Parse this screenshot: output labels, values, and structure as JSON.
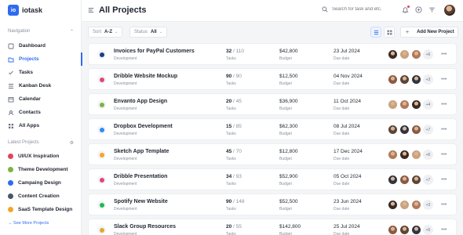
{
  "brand": {
    "mark": "io",
    "name": "iotask"
  },
  "sidebar": {
    "nav_heading": "Navigation",
    "nav_items": [
      {
        "label": "Dashboard",
        "icon": "dashboard-icon",
        "active": false
      },
      {
        "label": "Projects",
        "icon": "folder-icon",
        "active": true
      },
      {
        "label": "Tasks",
        "icon": "tasks-icon",
        "active": false
      },
      {
        "label": "Kanban Desk",
        "icon": "kanban-icon",
        "active": false
      },
      {
        "label": "Calendar",
        "icon": "calendar-icon",
        "active": false
      },
      {
        "label": "Contacts",
        "icon": "contacts-icon",
        "active": false
      },
      {
        "label": "All Apps",
        "icon": "apps-icon",
        "active": false
      }
    ],
    "latest_heading": "Latest Projects",
    "latest_items": [
      {
        "label": "UI/UX Inspiration",
        "color": "#e2445c"
      },
      {
        "label": "Theme Development",
        "color": "#7cb342"
      },
      {
        "label": "Campaing Design",
        "color": "#2f6bf0"
      },
      {
        "label": "Content Creation",
        "color": "#4a5568"
      },
      {
        "label": "SaaS Template Design",
        "color": "#f5a524"
      }
    ],
    "see_more": "See More Projects"
  },
  "header": {
    "title": "All Projects",
    "search_placeholder": "Search for task and etc."
  },
  "toolbar": {
    "sort_label": "Sort",
    "sort_value": "A-Z",
    "status_label": "Status",
    "status_value": "All",
    "add_label": "Add New Project"
  },
  "labels": {
    "tasks": "Tasks",
    "budget": "Budget",
    "due": "Due date"
  },
  "projects": [
    {
      "name": "Invoices for PayPal Customers",
      "category": "Development",
      "tasks_done": "32",
      "tasks_total": "/ 110",
      "budget": "$42,800",
      "due": "23 Jul 2024",
      "more": "+6",
      "icon_color": "#1a3d8f"
    },
    {
      "name": "Dribble Website Mockup",
      "category": "Development",
      "tasks_done": "90",
      "tasks_total": "/ 90",
      "budget": "$12,500",
      "due": "04 Nov 2024",
      "more": "+3",
      "icon_color": "#e2447c"
    },
    {
      "name": "Envanto App Design",
      "category": "Development",
      "tasks_done": "20",
      "tasks_total": "/ 45",
      "budget": "$36,900",
      "due": "11 Oct 2024",
      "more": "+4",
      "icon_color": "#7cb342"
    },
    {
      "name": "Dropbox Development",
      "category": "Development",
      "tasks_done": "15",
      "tasks_total": "/ 85",
      "budget": "$62,300",
      "due": "08 Jul 2024",
      "more": "+7",
      "icon_color": "#2f8bf0"
    },
    {
      "name": "Sketch App Template",
      "category": "Development",
      "tasks_done": "45",
      "tasks_total": "/ 70",
      "budget": "$12,800",
      "due": "17 Dec 2024",
      "more": "+6",
      "icon_color": "#f5a524"
    },
    {
      "name": "Dribble Presentation",
      "category": "Development",
      "tasks_done": "34",
      "tasks_total": "/ 93",
      "budget": "$52,900",
      "due": "05 Oct 2024",
      "more": "+7",
      "icon_color": "#e2447c"
    },
    {
      "name": "Spotify New Website",
      "category": "Development",
      "tasks_done": "90",
      "tasks_total": "/ 148",
      "budget": "$52,500",
      "due": "23 Jun 2024",
      "more": "+3",
      "icon_color": "#1db954"
    },
    {
      "name": "Slack Group Resources",
      "category": "Development",
      "tasks_done": "20",
      "tasks_total": "/ 55",
      "budget": "$142,800",
      "due": "25 Jul 2024",
      "more": "+5",
      "icon_color": "#e0a82e"
    }
  ],
  "avatar_palette": [
    "#3a2a24",
    "#8a5a44",
    "#c9a27e",
    "#5b4636",
    "#b07a5a",
    "#2e3440"
  ]
}
